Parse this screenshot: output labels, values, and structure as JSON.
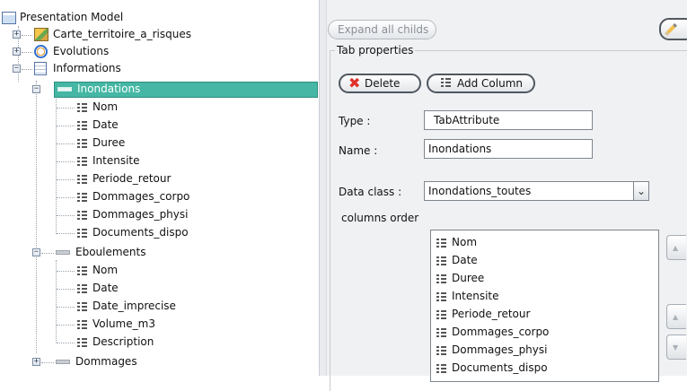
{
  "tree": {
    "root": {
      "label": "Presentation Model"
    },
    "carte": {
      "label": "Carte_territoire_a_risques"
    },
    "evolutions": {
      "label": "Evolutions"
    },
    "informations": {
      "label": "Informations"
    },
    "inondations": {
      "label": "Inondations",
      "children": [
        "Nom",
        "Date",
        "Duree",
        "Intensite",
        "Periode_retour",
        "Dommages_corpo",
        "Dommages_physi",
        "Documents_dispo"
      ]
    },
    "eboulements": {
      "label": "Eboulements",
      "children": [
        "Nom",
        "Date",
        "Date_imprecise",
        "Volume_m3",
        "Description"
      ]
    },
    "dommages": {
      "label": "Dommages"
    }
  },
  "toolbar": {
    "expand_all_label": "Expand all childs"
  },
  "tab_properties": {
    "legend": "Tab properties",
    "delete_label": "Delete",
    "add_column_label": "Add Column",
    "type_label": "Type :",
    "type_value": "TabAttribute",
    "name_label": "Name :",
    "name_value": "Inondations",
    "data_class_label": "Data class :",
    "data_class_value": "Inondations_toutes",
    "columns_order_label": "columns order",
    "columns": [
      "Nom",
      "Date",
      "Duree",
      "Intensite",
      "Periode_retour",
      "Dommages_corpo",
      "Dommages_physi",
      "Documents_dispo"
    ]
  },
  "colors": {
    "selection": "#45b7a4",
    "delete_icon": "#e0302a"
  }
}
